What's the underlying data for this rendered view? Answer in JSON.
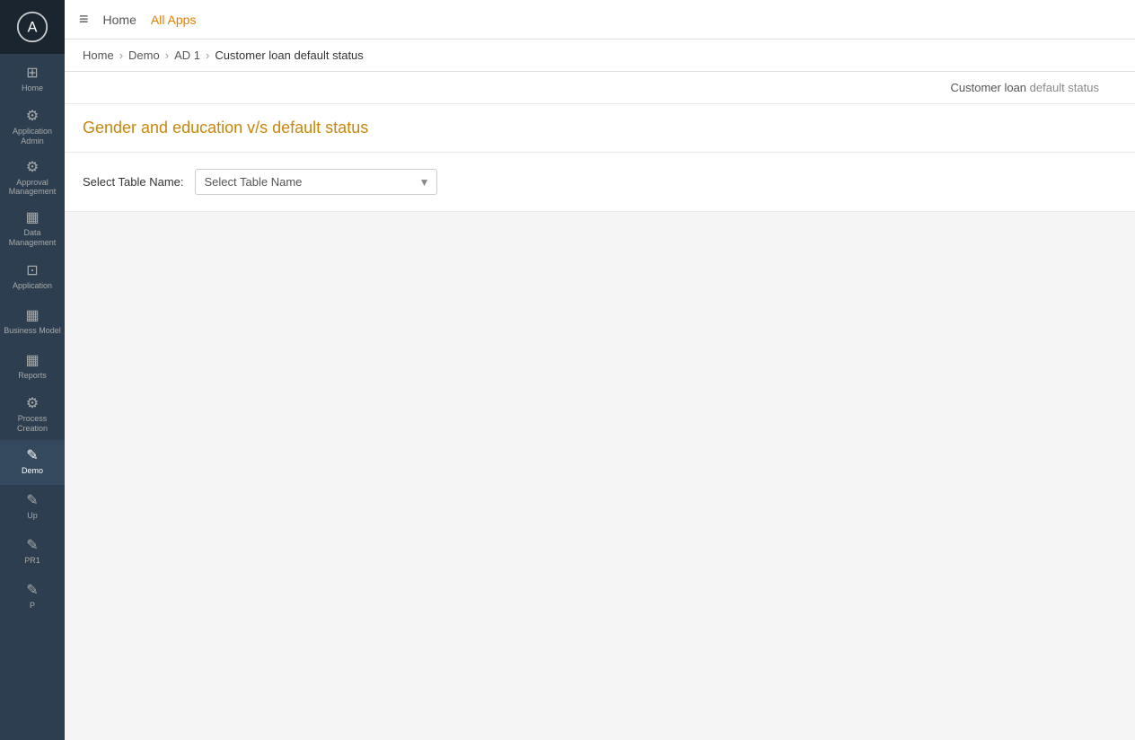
{
  "sidebar": {
    "logo_text": "A",
    "items": [
      {
        "id": "home",
        "label": "Home",
        "icon": "⊞"
      },
      {
        "id": "application-admin",
        "label": "Application Admin",
        "icon": "⚙"
      },
      {
        "id": "approval-management",
        "label": "Approval Management",
        "icon": "⚙"
      },
      {
        "id": "data-management",
        "label": "Data Management",
        "icon": "📊"
      },
      {
        "id": "application",
        "label": "Application",
        "icon": "⊡"
      },
      {
        "id": "business-model",
        "label": "Business Model",
        "icon": "📊"
      },
      {
        "id": "reports",
        "label": "Reports",
        "icon": "📊"
      },
      {
        "id": "process-creation",
        "label": "Process Creation",
        "icon": "⚙"
      },
      {
        "id": "demo",
        "label": "Demo",
        "icon": "✎"
      },
      {
        "id": "up",
        "label": "Up",
        "icon": "✎"
      },
      {
        "id": "pr1",
        "label": "PR1",
        "icon": "✎"
      },
      {
        "id": "p",
        "label": "P",
        "icon": "✎"
      }
    ]
  },
  "topbar": {
    "menu_icon": "≡",
    "home_label": "Home",
    "all_apps_label": "All Apps"
  },
  "breadcrumb": {
    "items": [
      {
        "label": "Home",
        "current": false
      },
      {
        "label": "Demo",
        "current": false
      },
      {
        "label": "AD 1",
        "current": false
      },
      {
        "label": "Customer loan default status",
        "current": true
      }
    ]
  },
  "content_header": {
    "text_prefix": "Customer loan",
    "text_suffix": " default status"
  },
  "page": {
    "title": "Gender and education v/s default status"
  },
  "filter": {
    "label": "Select Table Name:",
    "placeholder": "Select Table Name",
    "options": []
  }
}
